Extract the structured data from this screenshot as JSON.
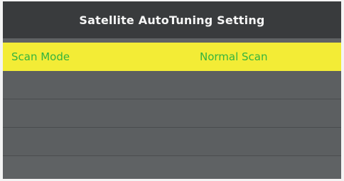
{
  "window": {
    "title": "Satellite AutoTuning Setting"
  },
  "menu": {
    "items": [
      {
        "label": "Scan Mode",
        "value": "Normal Scan",
        "selected": true
      },
      {
        "label": "",
        "value": "",
        "selected": false
      },
      {
        "label": "",
        "value": "",
        "selected": false
      },
      {
        "label": "",
        "value": "",
        "selected": false
      }
    ]
  },
  "colors": {
    "title_bar": "#393b3d",
    "panel": "#5f6264",
    "highlight": "#f3ec36",
    "text_green": "#34b43e",
    "title_text": "#f6f6f6"
  }
}
